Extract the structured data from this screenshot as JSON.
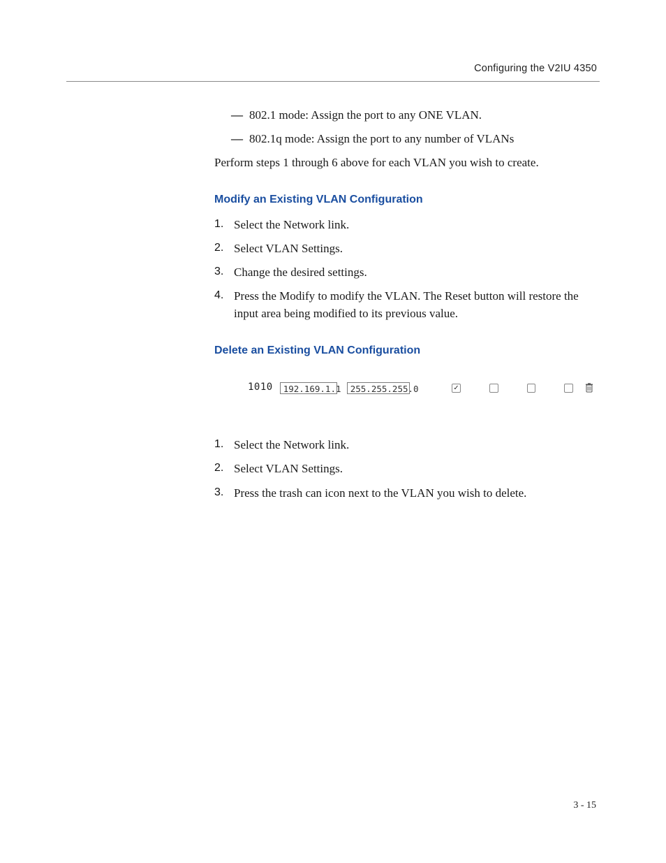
{
  "header": {
    "title": "Configuring the V2IU 4350"
  },
  "dash_items": [
    "802.1 mode: Assign the port to any ONE VLAN.",
    "802.1q mode: Assign the port to any number of VLANs"
  ],
  "para_perform": "Perform steps 1 through 6 above for each VLAN you wish to create.",
  "modify": {
    "heading": "Modify an Existing VLAN Configuration",
    "steps": [
      "Select the Network link.",
      "Select VLAN Settings.",
      "Change the desired settings.",
      "Press the Modify to modify the VLAN. The Reset button will restore the input area being modified to its previous value."
    ]
  },
  "delete": {
    "heading": "Delete an Existing VLAN Configuration",
    "steps": [
      "Select the Network link.",
      "Select VLAN Settings.",
      "Press the trash can icon next to the VLAN you wish to delete."
    ]
  },
  "screenshot": {
    "vlan_id": "1010",
    "ip_value": "192.169.1.1",
    "mask_value": "255.255.255.0",
    "checks": [
      true,
      false,
      false,
      false
    ]
  },
  "steps_numbers": {
    "n1": "1.",
    "n2": "2.",
    "n3": "3.",
    "n4": "4."
  },
  "page_number": "3 - 15"
}
